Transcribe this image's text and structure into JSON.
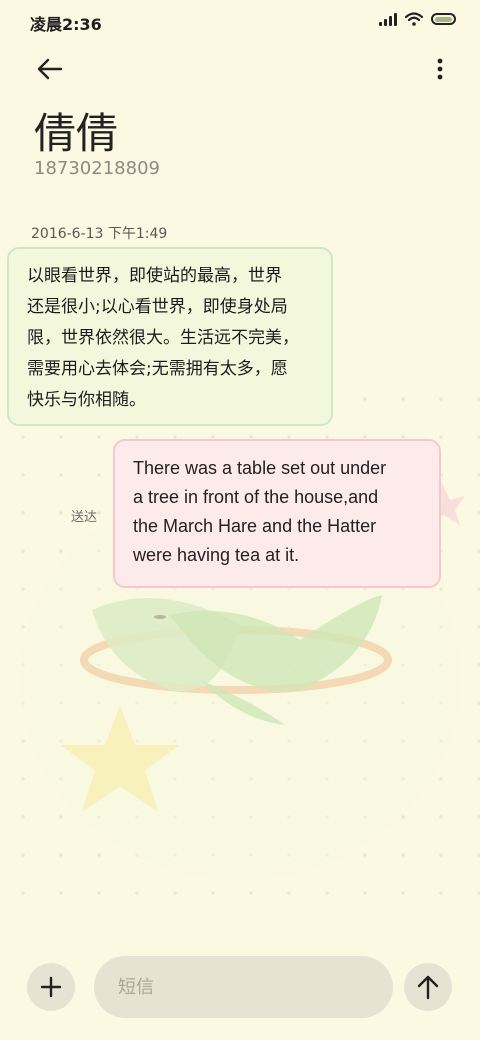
{
  "status_bar": {
    "time": "凌晨2:36",
    "icons": [
      "signal-icon",
      "wifi-icon",
      "battery-icon"
    ]
  },
  "header": {
    "back_icon": "arrow-left-icon",
    "more_icon": "more-vertical-icon"
  },
  "contact": {
    "name": "倩倩",
    "phone": "18730218809"
  },
  "conversation": {
    "timestamp": "2016-6-13 下午1:49",
    "received": {
      "lines": [
        "以眼看世界，即使站的最高，世界",
        "还是很小;以心看世界，即使身处局",
        "限，世界依然很大。生活远不完美，",
        "需要用心去体会;无需拥有太多，愿",
        "快乐与你相随。"
      ]
    },
    "sent": {
      "lines": [
        "There was a table set out under",
        "a tree in front of the house,and",
        "the March Hare and the Hatter",
        "were having tea at it."
      ],
      "status": "送达"
    }
  },
  "composer": {
    "add_icon": "plus-icon",
    "placeholder": "短信",
    "value": "",
    "send_icon": "arrow-up-icon"
  },
  "colors": {
    "background": "#fcf9e3",
    "received_bubble": "#f3f8dd",
    "received_border": "#cfe8c3",
    "sent_bubble": "#fdeaea",
    "sent_border": "#f5c8cf",
    "button_bg": "#e6e3d3"
  }
}
